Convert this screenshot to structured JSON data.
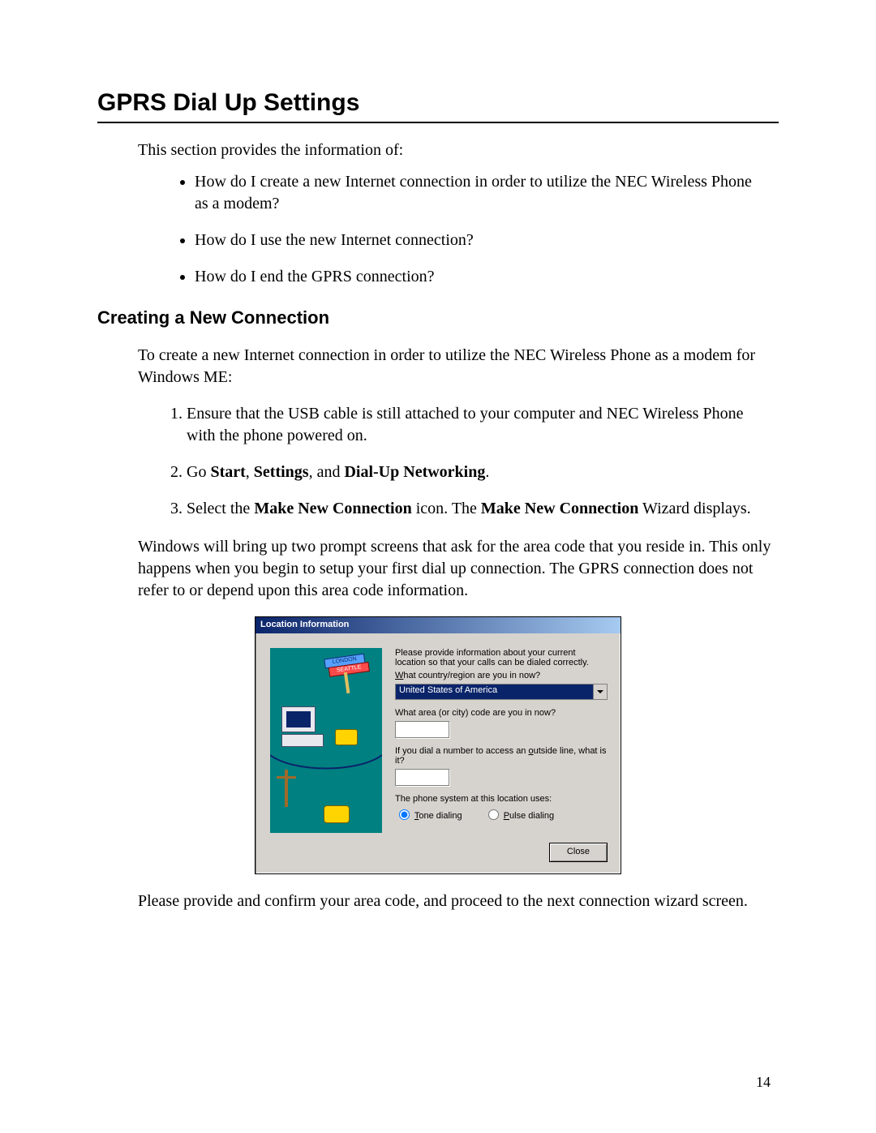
{
  "page_number": "14",
  "title": "GPRS Dial Up Settings",
  "intro": "This section provides the information of:",
  "bullets": [
    "How do I create a new Internet connection in order to utilize the NEC Wireless Phone as a modem?",
    "How do I use the new Internet connection?",
    "How do I end the GPRS connection?"
  ],
  "section_heading": "Creating a New Connection",
  "section_intro": "To create a new Internet connection in order to utilize the NEC Wireless Phone as a modem for Windows ME:",
  "steps": {
    "s1": "Ensure that the USB cable is still attached to your computer and NEC Wireless Phone with the phone powered on.",
    "s2_prefix": "Go ",
    "s2_b1": "Start",
    "s2_mid1": ", ",
    "s2_b2": "Settings",
    "s2_mid2": ", and ",
    "s2_b3": "Dial-Up Networking",
    "s2_suffix": ".",
    "s3_prefix": "Select the ",
    "s3_b1": "Make New Connection",
    "s3_mid1": " icon.  The ",
    "s3_b2": "Make New Connection",
    "s3_suffix": " Wizard displays."
  },
  "mid_paragraph": "Windows will bring up two prompt screens that ask for the area code that you reside in.  This only happens when you begin to setup your first dial up connection.  The GPRS connection does not refer to or depend upon this area code information.",
  "after_dialog": "Please provide and confirm your area code, and proceed to the next connection wizard screen.",
  "dialog": {
    "title": "Location Information",
    "intro": "Please provide information about your current location so that your calls can be dialed correctly.",
    "q_country_pre": "W",
    "q_country_rest": "hat country/region are you in now?",
    "country_value": "United States of America",
    "q_area": "What area (or city) code are you in now?",
    "q_outside_pre": "If you dial a number to access an ",
    "q_outside_u": "o",
    "q_outside_rest": "utside line, what is it?",
    "phone_system_label": "The phone system at this location uses:",
    "radio_tone_u": "T",
    "radio_tone_rest": "one dialing",
    "radio_pulse_u": "P",
    "radio_pulse_rest": "ulse dialing",
    "close_u": "C",
    "close_rest": "lose",
    "sign_top": "LONDON",
    "sign_bottom": "SEATTLE"
  }
}
